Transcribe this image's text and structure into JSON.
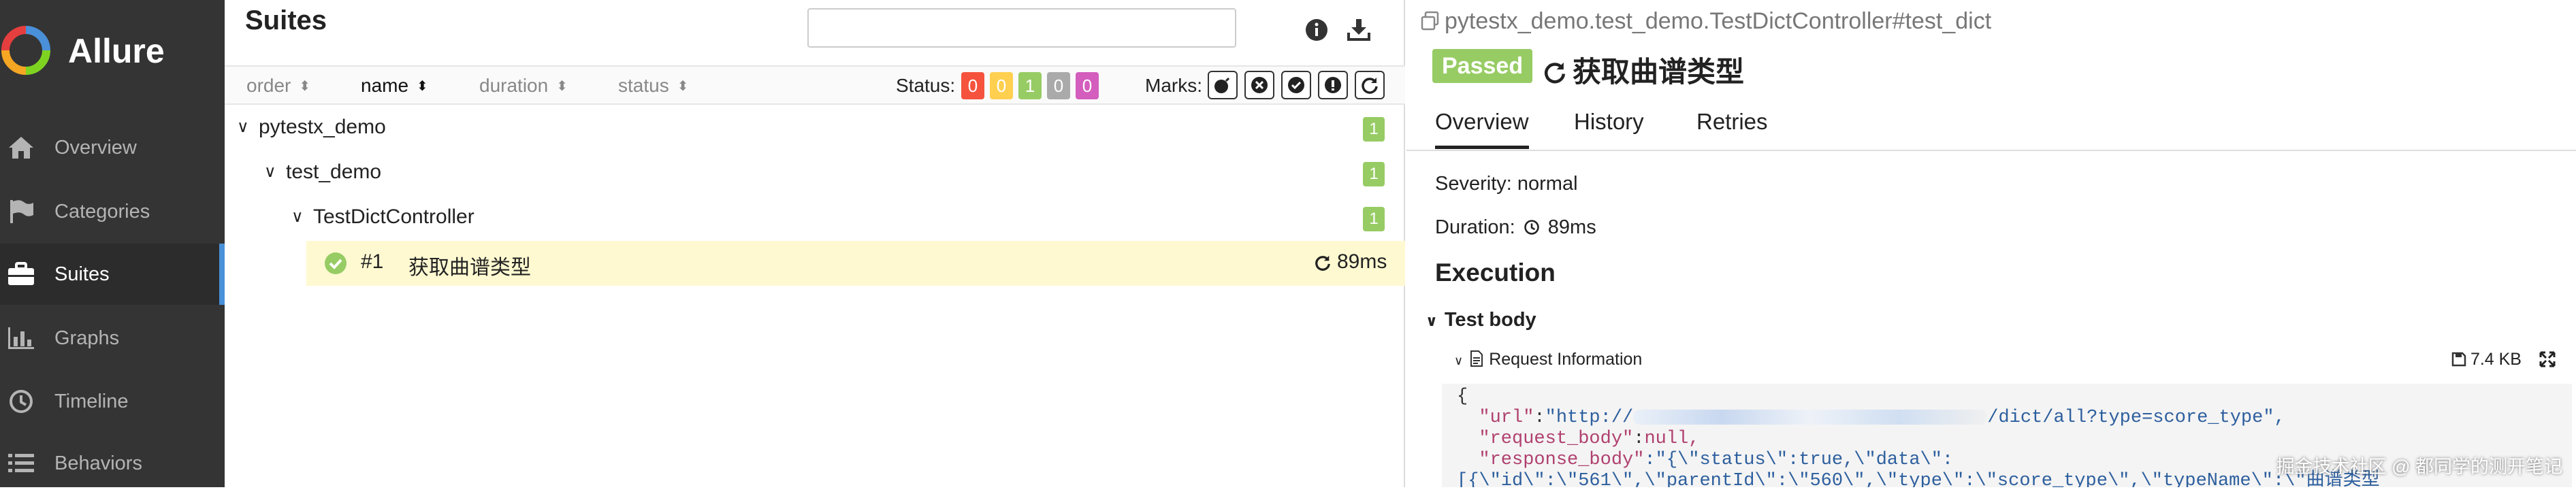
{
  "sidebar": {
    "brand": "Allure",
    "items": [
      {
        "label": "Overview",
        "icon": "home-icon"
      },
      {
        "label": "Categories",
        "icon": "flag-icon"
      },
      {
        "label": "Suites",
        "icon": "briefcase-icon",
        "active": true
      },
      {
        "label": "Graphs",
        "icon": "bar-chart-icon"
      },
      {
        "label": "Timeline",
        "icon": "clock-icon"
      },
      {
        "label": "Behaviors",
        "icon": "list-icon"
      }
    ]
  },
  "suites": {
    "title": "Suites",
    "search_placeholder": "",
    "sort": {
      "order": "order",
      "name": "name",
      "duration": "duration",
      "status": "status"
    },
    "status_label": "Status:",
    "status_counts": [
      {
        "value": "0",
        "color": "#f5533d"
      },
      {
        "value": "0",
        "color": "#ffd050"
      },
      {
        "value": "1",
        "color": "#97cc64"
      },
      {
        "value": "0",
        "color": "#aaaaaa"
      },
      {
        "value": "0",
        "color": "#d35ebe"
      }
    ],
    "marks_label": "Marks:",
    "tree": [
      {
        "name": "pytestx_demo",
        "count": "1"
      },
      {
        "name": "test_demo",
        "count": "1"
      },
      {
        "name": "TestDictController",
        "count": "1"
      }
    ],
    "leaf": {
      "number": "#1",
      "name": "获取曲谱类型",
      "duration": "89ms"
    }
  },
  "testcase": {
    "full_name": "pytestx_demo.test_demo.TestDictController#test_dict",
    "status": "Passed",
    "name": "获取曲谱类型",
    "tabs": [
      "Overview",
      "History",
      "Retries"
    ],
    "severity": "Severity: normal",
    "duration_label": "Duration:",
    "duration": "89ms",
    "execution": "Execution",
    "test_body": "Test body",
    "attachment": "Request Information",
    "attachment_size": "7.4 KB",
    "code": {
      "line1": "{",
      "url_key": "\"url\"",
      "url_prefix": "\"http://",
      "url_suffix": "/dict/all?type=score_type\",",
      "body_key": "\"request_body\"",
      "body_val": "null,",
      "resp_key": "\"response_body\"",
      "resp_val": ":\"{\\\"status\\\":true,\\\"data\\\":",
      "line5": "[{\\\"id\\\":\\\"561\\\",\\\"parentId\\\":\\\"560\\\",\\\"type\\\":\\\"score_type\\\",\\\"typeName\\\":\\\"曲谱类型"
    }
  },
  "watermark": "掘金技术社区 @ 都同学的测开笔记"
}
